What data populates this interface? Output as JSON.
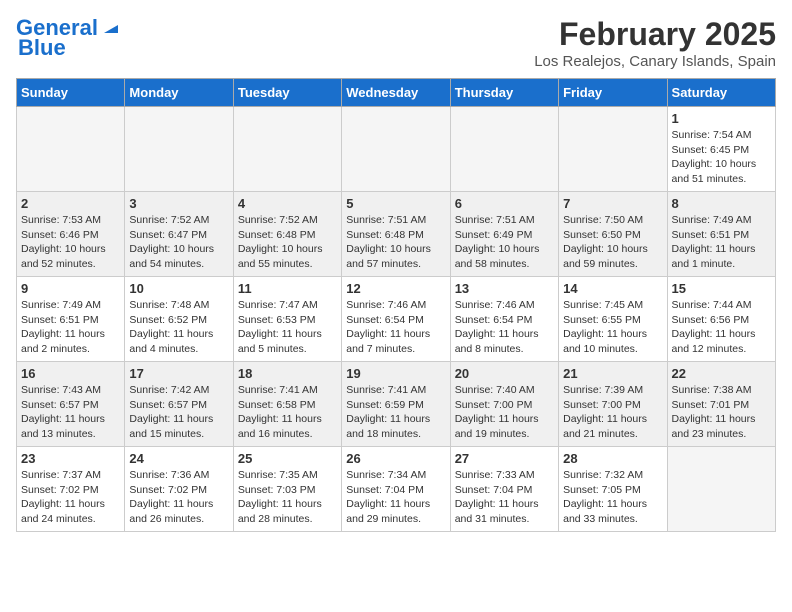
{
  "header": {
    "logo_line1": "General",
    "logo_line2": "Blue",
    "title": "February 2025",
    "subtitle": "Los Realejos, Canary Islands, Spain"
  },
  "weekdays": [
    "Sunday",
    "Monday",
    "Tuesday",
    "Wednesday",
    "Thursday",
    "Friday",
    "Saturday"
  ],
  "weeks": [
    [
      {
        "day": "",
        "info": ""
      },
      {
        "day": "",
        "info": ""
      },
      {
        "day": "",
        "info": ""
      },
      {
        "day": "",
        "info": ""
      },
      {
        "day": "",
        "info": ""
      },
      {
        "day": "",
        "info": ""
      },
      {
        "day": "1",
        "info": "Sunrise: 7:54 AM\nSunset: 6:45 PM\nDaylight: 10 hours\nand 51 minutes."
      }
    ],
    [
      {
        "day": "2",
        "info": "Sunrise: 7:53 AM\nSunset: 6:46 PM\nDaylight: 10 hours\nand 52 minutes."
      },
      {
        "day": "3",
        "info": "Sunrise: 7:52 AM\nSunset: 6:47 PM\nDaylight: 10 hours\nand 54 minutes."
      },
      {
        "day": "4",
        "info": "Sunrise: 7:52 AM\nSunset: 6:48 PM\nDaylight: 10 hours\nand 55 minutes."
      },
      {
        "day": "5",
        "info": "Sunrise: 7:51 AM\nSunset: 6:48 PM\nDaylight: 10 hours\nand 57 minutes."
      },
      {
        "day": "6",
        "info": "Sunrise: 7:51 AM\nSunset: 6:49 PM\nDaylight: 10 hours\nand 58 minutes."
      },
      {
        "day": "7",
        "info": "Sunrise: 7:50 AM\nSunset: 6:50 PM\nDaylight: 10 hours\nand 59 minutes."
      },
      {
        "day": "8",
        "info": "Sunrise: 7:49 AM\nSunset: 6:51 PM\nDaylight: 11 hours\nand 1 minute."
      }
    ],
    [
      {
        "day": "9",
        "info": "Sunrise: 7:49 AM\nSunset: 6:51 PM\nDaylight: 11 hours\nand 2 minutes."
      },
      {
        "day": "10",
        "info": "Sunrise: 7:48 AM\nSunset: 6:52 PM\nDaylight: 11 hours\nand 4 minutes."
      },
      {
        "day": "11",
        "info": "Sunrise: 7:47 AM\nSunset: 6:53 PM\nDaylight: 11 hours\nand 5 minutes."
      },
      {
        "day": "12",
        "info": "Sunrise: 7:46 AM\nSunset: 6:54 PM\nDaylight: 11 hours\nand 7 minutes."
      },
      {
        "day": "13",
        "info": "Sunrise: 7:46 AM\nSunset: 6:54 PM\nDaylight: 11 hours\nand 8 minutes."
      },
      {
        "day": "14",
        "info": "Sunrise: 7:45 AM\nSunset: 6:55 PM\nDaylight: 11 hours\nand 10 minutes."
      },
      {
        "day": "15",
        "info": "Sunrise: 7:44 AM\nSunset: 6:56 PM\nDaylight: 11 hours\nand 12 minutes."
      }
    ],
    [
      {
        "day": "16",
        "info": "Sunrise: 7:43 AM\nSunset: 6:57 PM\nDaylight: 11 hours\nand 13 minutes."
      },
      {
        "day": "17",
        "info": "Sunrise: 7:42 AM\nSunset: 6:57 PM\nDaylight: 11 hours\nand 15 minutes."
      },
      {
        "day": "18",
        "info": "Sunrise: 7:41 AM\nSunset: 6:58 PM\nDaylight: 11 hours\nand 16 minutes."
      },
      {
        "day": "19",
        "info": "Sunrise: 7:41 AM\nSunset: 6:59 PM\nDaylight: 11 hours\nand 18 minutes."
      },
      {
        "day": "20",
        "info": "Sunrise: 7:40 AM\nSunset: 7:00 PM\nDaylight: 11 hours\nand 19 minutes."
      },
      {
        "day": "21",
        "info": "Sunrise: 7:39 AM\nSunset: 7:00 PM\nDaylight: 11 hours\nand 21 minutes."
      },
      {
        "day": "22",
        "info": "Sunrise: 7:38 AM\nSunset: 7:01 PM\nDaylight: 11 hours\nand 23 minutes."
      }
    ],
    [
      {
        "day": "23",
        "info": "Sunrise: 7:37 AM\nSunset: 7:02 PM\nDaylight: 11 hours\nand 24 minutes."
      },
      {
        "day": "24",
        "info": "Sunrise: 7:36 AM\nSunset: 7:02 PM\nDaylight: 11 hours\nand 26 minutes."
      },
      {
        "day": "25",
        "info": "Sunrise: 7:35 AM\nSunset: 7:03 PM\nDaylight: 11 hours\nand 28 minutes."
      },
      {
        "day": "26",
        "info": "Sunrise: 7:34 AM\nSunset: 7:04 PM\nDaylight: 11 hours\nand 29 minutes."
      },
      {
        "day": "27",
        "info": "Sunrise: 7:33 AM\nSunset: 7:04 PM\nDaylight: 11 hours\nand 31 minutes."
      },
      {
        "day": "28",
        "info": "Sunrise: 7:32 AM\nSunset: 7:05 PM\nDaylight: 11 hours\nand 33 minutes."
      },
      {
        "day": "",
        "info": ""
      }
    ]
  ]
}
